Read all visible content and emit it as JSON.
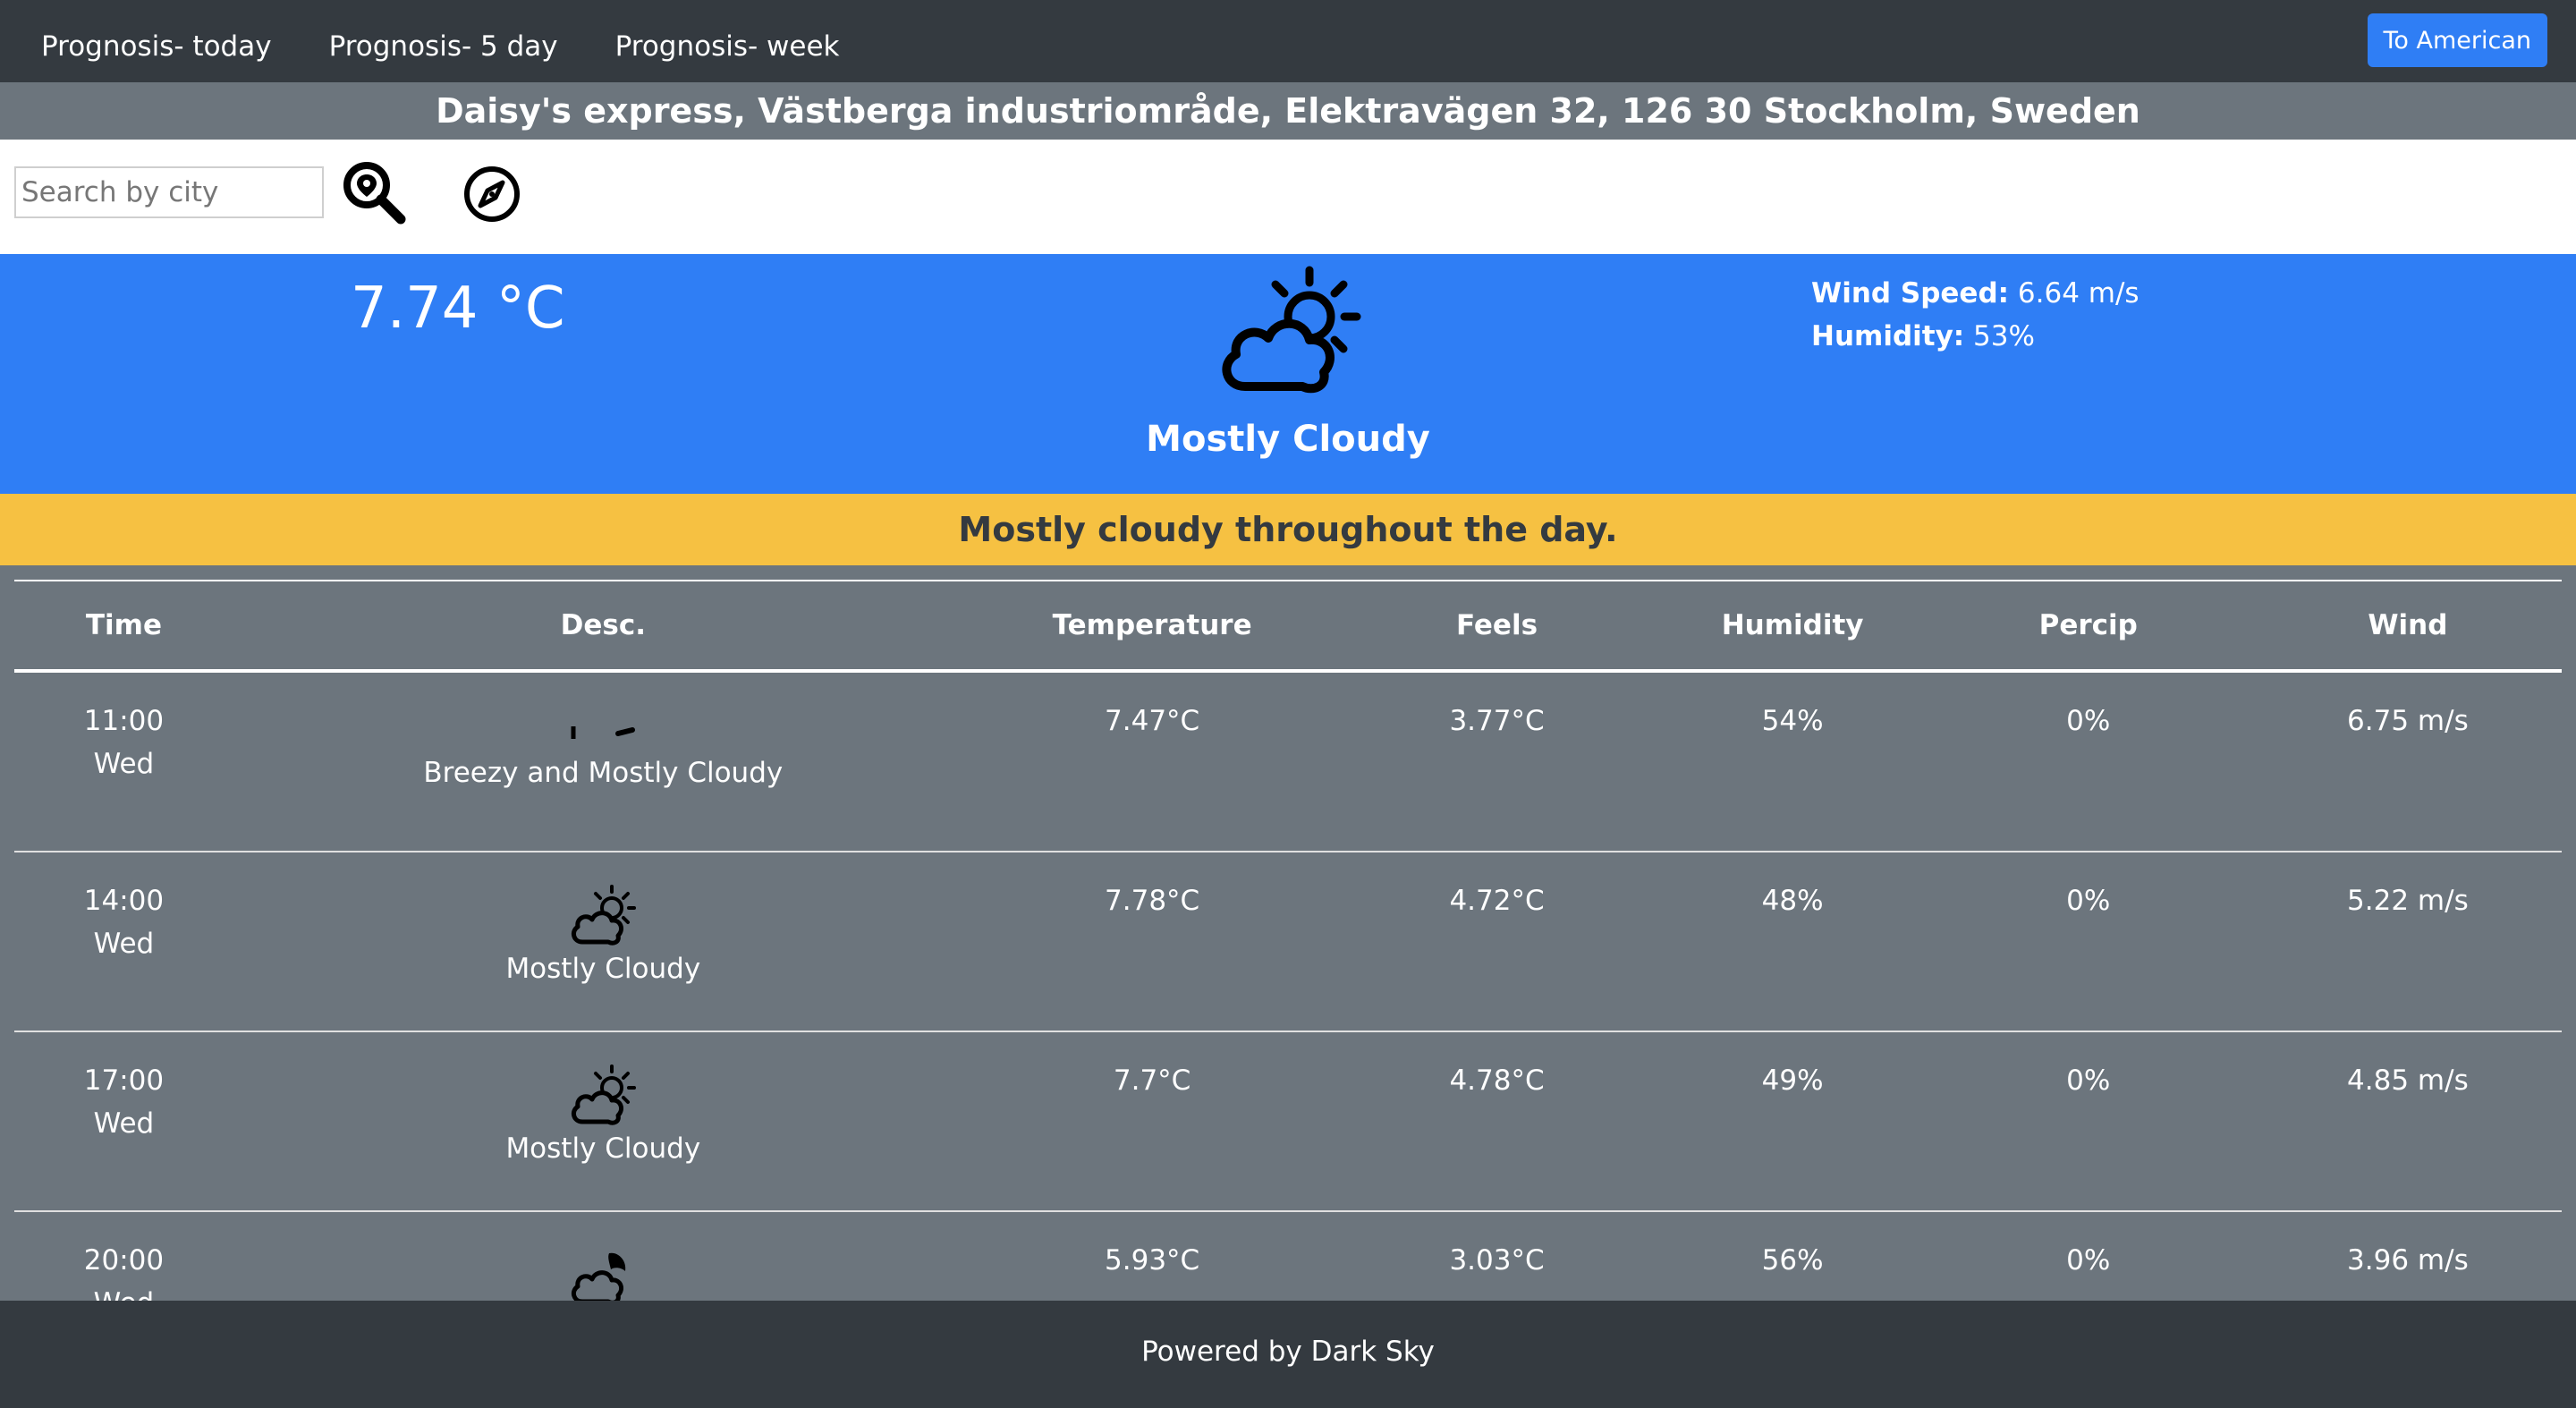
{
  "nav": {
    "links": [
      "Prognosis- today",
      "Prognosis- 5 day",
      "Prognosis- week"
    ],
    "unit_button": "To American"
  },
  "location": {
    "address": "Daisy's express, Västberga industriområde, Elektravägen 32, 126 30 Stockholm, Sweden"
  },
  "search": {
    "placeholder": "Search by city",
    "value": "",
    "search_icon": "magnifier-pin-icon",
    "locate_icon": "compass-icon"
  },
  "current": {
    "temperature": "7.74 °C",
    "icon": "partly-cloudy-day-icon",
    "summary": "Mostly Cloudy",
    "wind_label": "Wind Speed:",
    "wind_value": "6.64 m/s",
    "humidity_label": "Humidity:",
    "humidity_value": "53%"
  },
  "day_summary": "Mostly cloudy throughout the day.",
  "table": {
    "headers": [
      "Time",
      "Desc.",
      "Temperature",
      "Feels",
      "Humidity",
      "Percip",
      "Wind"
    ],
    "rows": [
      {
        "time": "11:00",
        "day": "Wed",
        "icon": "wind-icon",
        "desc": "Breezy and Mostly Cloudy",
        "temp": "7.47°C",
        "feels": "3.77°C",
        "humidity": "54%",
        "percip": "0%",
        "wind": "6.75 m/s"
      },
      {
        "time": "14:00",
        "day": "Wed",
        "icon": "partly-cloudy-day-icon",
        "desc": "Mostly Cloudy",
        "temp": "7.78°C",
        "feels": "4.72°C",
        "humidity": "48%",
        "percip": "0%",
        "wind": "5.22 m/s"
      },
      {
        "time": "17:00",
        "day": "Wed",
        "icon": "partly-cloudy-day-icon",
        "desc": "Mostly Cloudy",
        "temp": "7.7°C",
        "feels": "4.78°C",
        "humidity": "49%",
        "percip": "0%",
        "wind": "4.85 m/s"
      },
      {
        "time": "20:00",
        "day": "Wed",
        "icon": "partly-cloudy-night-icon",
        "desc": "",
        "temp": "5.93°C",
        "feels": "3.03°C",
        "humidity": "56%",
        "percip": "0%",
        "wind": "3.96 m/s"
      }
    ]
  },
  "footer": "Powered by Dark Sky",
  "colors": {
    "navbar": "#343a40",
    "accent_blue": "#2f7ef5",
    "summary_yellow": "#f6c142",
    "table_bg": "#6c757d"
  }
}
